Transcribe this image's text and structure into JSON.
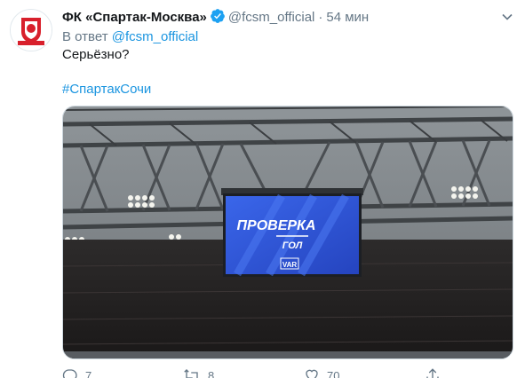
{
  "tweet": {
    "author_name": "ФК «Спартак-Москва»",
    "handle": "@fcsm_official",
    "separator": "·",
    "time": "54 мин",
    "reply_prefix": "В ответ",
    "reply_to": "@fcsm_official",
    "text": "Серьёзно?",
    "hashtag": "#СпартакСочи",
    "avatar_text": "СПАРТАК",
    "media": {
      "screen_title": "ПРОВЕРКА",
      "screen_subtitle": "ГОЛ",
      "screen_badge": "VAR"
    }
  },
  "actions": {
    "reply_count": "7",
    "retweet_count": "8",
    "like_count": "70"
  },
  "colors": {
    "accent": "#1b95e0",
    "secondary_text": "#657786",
    "brand_red": "#d8202c",
    "screen_blue": "#2f57d6"
  },
  "icons": [
    "verified-icon",
    "chevron-down-icon",
    "reply-icon",
    "retweet-icon",
    "like-icon",
    "share-icon"
  ]
}
